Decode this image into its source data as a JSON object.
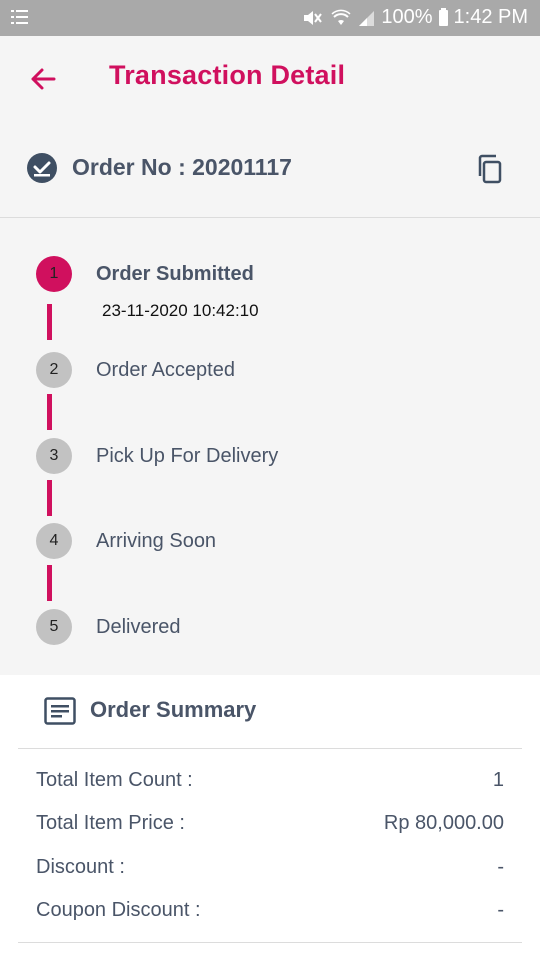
{
  "status_bar": {
    "battery": "100%",
    "time": "1:42 PM"
  },
  "header": {
    "title": "Transaction Detail"
  },
  "order": {
    "label": "Order No : 20201117"
  },
  "timeline": {
    "steps": [
      {
        "number": "1",
        "label": "Order Submitted",
        "date": "23-11-2020 10:42:10",
        "state": "active"
      },
      {
        "number": "2",
        "label": "Order Accepted",
        "state": "pending"
      },
      {
        "number": "3",
        "label": "Pick Up For Delivery",
        "state": "pending"
      },
      {
        "number": "4",
        "label": "Arriving Soon",
        "state": "pending"
      },
      {
        "number": "5",
        "label": "Delivered",
        "state": "pending"
      }
    ]
  },
  "summary": {
    "title": "Order Summary",
    "rows": [
      {
        "label": "Total Item Count :",
        "value": "1"
      },
      {
        "label": "Total Item Price :",
        "value": "Rp 80,000.00"
      },
      {
        "label": "Discount :",
        "value": "-"
      },
      {
        "label": "Coupon Discount :",
        "value": "-"
      }
    ]
  },
  "colors": {
    "accent": "#d0105e",
    "text": "#4a5568",
    "inactive_step": "#c2c2c2"
  },
  "icons": {
    "back": "arrow-left-icon",
    "order": "check-circle-icon",
    "copy": "copy-icon",
    "summary": "receipt-icon"
  }
}
